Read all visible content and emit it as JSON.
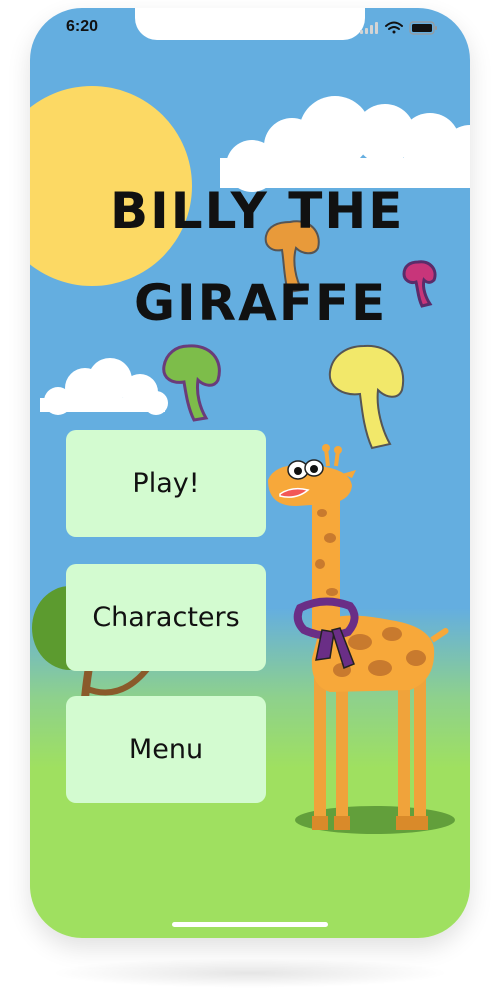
{
  "status_bar": {
    "time": "6:20"
  },
  "title": {
    "line1": "BILLY THE",
    "line2": "GIRAFFE"
  },
  "menu": {
    "play_label": "Play!",
    "characters_label": "Characters",
    "menu_label": "Menu"
  },
  "colors": {
    "sky": "#64aee0",
    "grass": "#9fe060",
    "sun": "#fcd964",
    "button_bg": "#d3fbd0",
    "giraffe_body": "#f7a83a",
    "giraffe_spots": "#c87a2e",
    "scarf": "#6a2e86"
  },
  "icons": [
    "wifi-icon",
    "signal-icon",
    "battery-icon"
  ]
}
